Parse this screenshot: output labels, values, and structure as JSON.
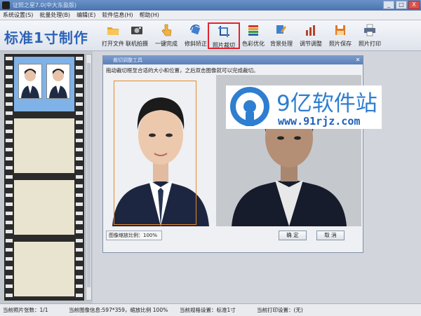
{
  "window": {
    "title": "证照之星7.0(中大东盈版)",
    "controls": [
      "_",
      "□",
      "X"
    ]
  },
  "menu": {
    "items": [
      "系统设置(S)",
      "批量处理(B)",
      "编辑(E)",
      "软件信息(H)",
      "帮助(H)"
    ]
  },
  "toolbar": {
    "brand": "标准1寸制作",
    "tools": [
      {
        "label": "打开文件",
        "icon": "folder-open-icon"
      },
      {
        "label": "联机拍摄",
        "icon": "camera-icon"
      },
      {
        "label": "一键完成",
        "icon": "hand-click-icon"
      },
      {
        "label": "修斜矫正",
        "icon": "rotate-correct-icon"
      },
      {
        "label": "照片裁切",
        "icon": "crop-icon",
        "active": true
      },
      {
        "label": "色彩优化",
        "icon": "color-bars-icon"
      },
      {
        "label": "背景处理",
        "icon": "brush-icon"
      },
      {
        "label": "调节调整",
        "icon": "adjust-chart-icon"
      },
      {
        "label": "照片保存",
        "icon": "floppy-save-icon"
      },
      {
        "label": "照片打印",
        "icon": "printer-icon"
      }
    ]
  },
  "dialog": {
    "title": "裁切调整工具",
    "hint": "拖动裁切框至合适的大小和位置，之后双击图像就可以完成裁切。",
    "zoom_label": "图像缩放比例：100%",
    "ok_label": "确 定",
    "cancel_label": "取 消"
  },
  "watermark": {
    "title": "9亿软件站",
    "url": "www.91rjz.com"
  },
  "status": {
    "photo_count": "当前照片张数：1/1",
    "image_info": "当前图像信息:597*359，缩放比例 100%",
    "spec": "当前规格设置：标准1寸",
    "print": "当前打印设置：(无)"
  },
  "colors": {
    "accent": "#2d63b8",
    "active_border": "#e0242f",
    "crop_frame": "#e88a2a"
  }
}
